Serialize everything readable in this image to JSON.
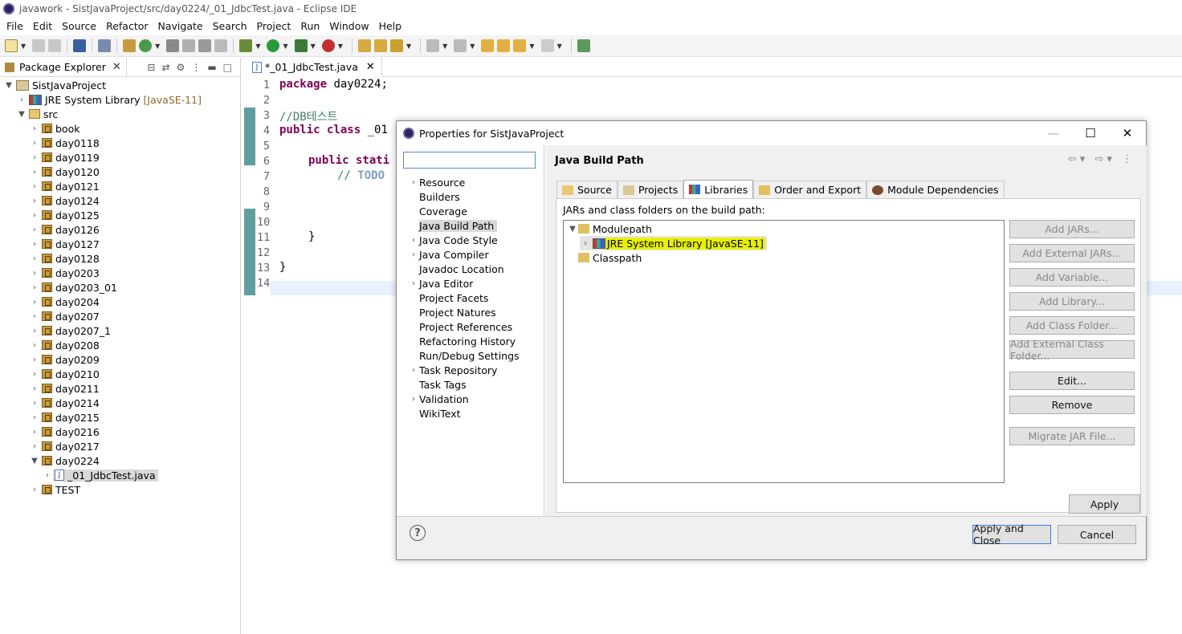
{
  "window": {
    "title": "javawork - SistJavaProject/src/day0224/_01_JdbcTest.java - Eclipse IDE"
  },
  "menu": [
    "File",
    "Edit",
    "Source",
    "Refactor",
    "Navigate",
    "Search",
    "Project",
    "Run",
    "Window",
    "Help"
  ],
  "package_explorer": {
    "tab_label": "Package Explorer",
    "project": "SistJavaProject",
    "jre": {
      "label": "JRE System Library",
      "decoration": "[JavaSE-11]"
    },
    "src": "src",
    "packages": [
      "book",
      "day0118",
      "day0119",
      "day0120",
      "day0121",
      "day0124",
      "day0125",
      "day0126",
      "day0127",
      "day0128",
      "day0203",
      "day0203_01",
      "day0204",
      "day0207",
      "day0207_1",
      "day0208",
      "day0209",
      "day0210",
      "day0211",
      "day0214",
      "day0215",
      "day0216",
      "day0217",
      "day0224"
    ],
    "open_file": "_01_JdbcTest.java",
    "after": "TEST"
  },
  "editor": {
    "tab_label": "*_01_JdbcTest.java",
    "line_numbers": [
      "1",
      "2",
      "3",
      "4",
      "5",
      "6",
      "7",
      "8",
      "9",
      "10",
      "11",
      "12",
      "13",
      "14"
    ],
    "l1_kw": "package",
    "l1_rest": " day0224;",
    "l3_comment": "//DB테스트",
    "l4_kw": "public class",
    "l4_rest": " _01",
    "l6_kw": "public stati",
    "l7_comment": "// ",
    "l7_todo": "TODO",
    "l11": "}",
    "l13": "}"
  },
  "dialog": {
    "title": "Properties for SistJavaProject",
    "filter_value": "",
    "nav_items": [
      "Resource",
      "Builders",
      "Coverage",
      "Java Build Path",
      "Java Code Style",
      "Java Compiler",
      "Javadoc Location",
      "Java Editor",
      "Project Facets",
      "Project Natures",
      "Project References",
      "Refactoring History",
      "Run/Debug Settings",
      "Task Repository",
      "Task Tags",
      "Validation",
      "WikiText"
    ],
    "page_title": "Java Build Path",
    "tabs": [
      "Source",
      "Projects",
      "Libraries",
      "Order and Export",
      "Module Dependencies"
    ],
    "panel_label": "JARs and class folders on the build path:",
    "tree": {
      "modulepath": "Modulepath",
      "jre": "JRE System Library [JavaSE-11]",
      "classpath": "Classpath"
    },
    "buttons": [
      "Add JARs...",
      "Add External JARs...",
      "Add Variable...",
      "Add Library...",
      "Add Class Folder...",
      "Add External Class Folder...",
      "Edit...",
      "Remove",
      "Migrate JAR File..."
    ],
    "apply": "Apply",
    "apply_close": "Apply and Close",
    "cancel": "Cancel",
    "help": "?"
  }
}
